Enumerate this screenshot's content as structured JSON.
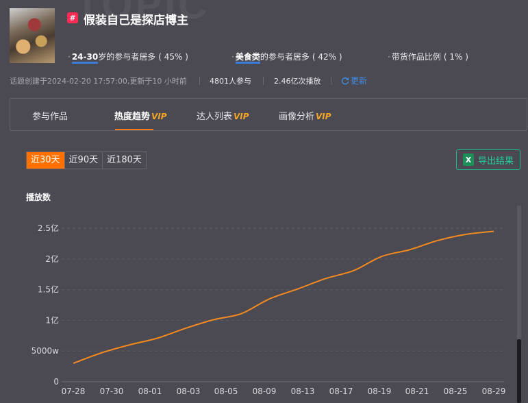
{
  "topic": {
    "watermark": "TOPIC",
    "hash_icon": "#",
    "title": "假装自己是探店博主"
  },
  "stats": [
    {
      "highlight": "24-30",
      "text": "岁的参与者居多",
      "pct": "( 45% )"
    },
    {
      "highlight": "美食类",
      "text": "的参与者居多",
      "pct": "( 42% )"
    },
    {
      "highlight": "",
      "text": "带货作品比例",
      "pct": "( 1% )"
    }
  ],
  "meta": {
    "created": "话题创建于2024-02-20 17:57:00,更新于10 小时前",
    "participants": "4801人参与",
    "plays": "2.46亿次播放",
    "refresh": "更新"
  },
  "tabs": [
    {
      "label": "参与作品",
      "vip": ""
    },
    {
      "label": "热度趋势",
      "vip": "VIP"
    },
    {
      "label": "达人列表",
      "vip": "VIP"
    },
    {
      "label": "画像分析",
      "vip": "VIP"
    }
  ],
  "range": {
    "options": [
      "近30天",
      "近90天",
      "近180天"
    ],
    "selected": "近30天"
  },
  "export": {
    "label": "导出结果",
    "icon": "excel-icon"
  },
  "colors": {
    "accent": "#ff7200",
    "line": "#f58a1f",
    "export": "#1fce9a",
    "refresh": "#3f8ee8"
  },
  "chart_data": {
    "type": "line",
    "ylabel": "播放数",
    "x_ticks": [
      "07-28",
      "07-30",
      "08-01",
      "08-03",
      "08-05",
      "08-09",
      "08-13",
      "08-17",
      "08-19",
      "08-21",
      "08-25",
      "08-29"
    ],
    "y_ticks": [
      "0",
      "5000w",
      "1亿",
      "1.5亿",
      "2亿",
      "2.5亿"
    ],
    "ylim": [
      0,
      250000000
    ],
    "grid": true,
    "series": [
      {
        "name": "",
        "values": [
          30000000,
          47000000,
          60000000,
          71000000,
          87000000,
          101000000,
          111000000,
          135000000,
          151000000,
          168000000,
          181000000,
          204000000,
          215000000,
          230000000,
          240000000,
          245000000
        ]
      }
    ]
  }
}
